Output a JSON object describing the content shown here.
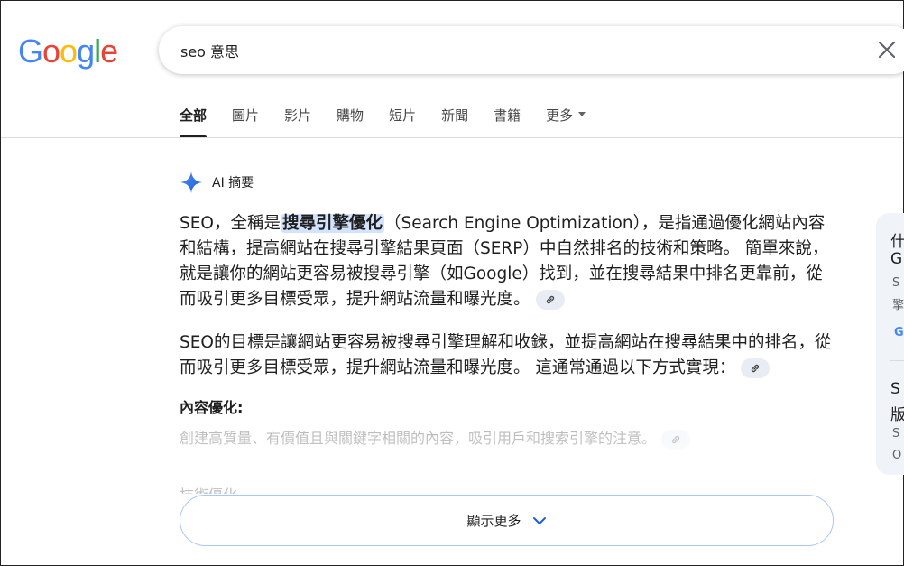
{
  "logo": {
    "letters": [
      "G",
      "o",
      "o",
      "g",
      "l",
      "e"
    ],
    "colors": [
      "#4285F4",
      "#EA4335",
      "#FBBC05",
      "#4285F4",
      "#34A853",
      "#EA4335"
    ]
  },
  "search": {
    "value": "seo 意思",
    "clear_icon": "close-icon"
  },
  "tabs": [
    {
      "label": "全部",
      "active": true
    },
    {
      "label": "圖片"
    },
    {
      "label": "影片"
    },
    {
      "label": "購物"
    },
    {
      "label": "短片"
    },
    {
      "label": "新聞"
    },
    {
      "label": "書籍"
    },
    {
      "label": "更多"
    }
  ],
  "ai_overview": {
    "icon": "sparkle-icon",
    "title": "AI 摘要",
    "para1": {
      "pre": "SEO，全稱是",
      "highlight": "搜尋引擎優化",
      "post": "（Search Engine Optimization），是指通過優化網站內容和結構，提高網站在搜尋引擎結果頁面（SERP）中自然排名的技術和策略。 簡單來說，就是讓你的網站更容易被搜尋引擎（如Google）找到，並在搜尋結果中排名更靠前，從而吸引更多目標受眾，提升網站流量和曝光度。"
    },
    "para2": "SEO的目標是讓網站更容易被搜尋引擎理解和收錄，並提高網站在搜尋結果中的排名，從而吸引更多目標受眾，提升網站流量和曝光度。 這通常通過以下方式實現：",
    "subhead": "內容優化:",
    "subtext": "創建高質量、有價值且與關鍵字相關的內容，吸引用戶和搜索引擎的注意。",
    "cut_text": "技術優化",
    "show_more": "顯示更多"
  },
  "side_panel": {
    "lines": [
      "什",
      "G",
      "S",
      "擎",
      "S",
      "版",
      "S",
      "O"
    ]
  }
}
